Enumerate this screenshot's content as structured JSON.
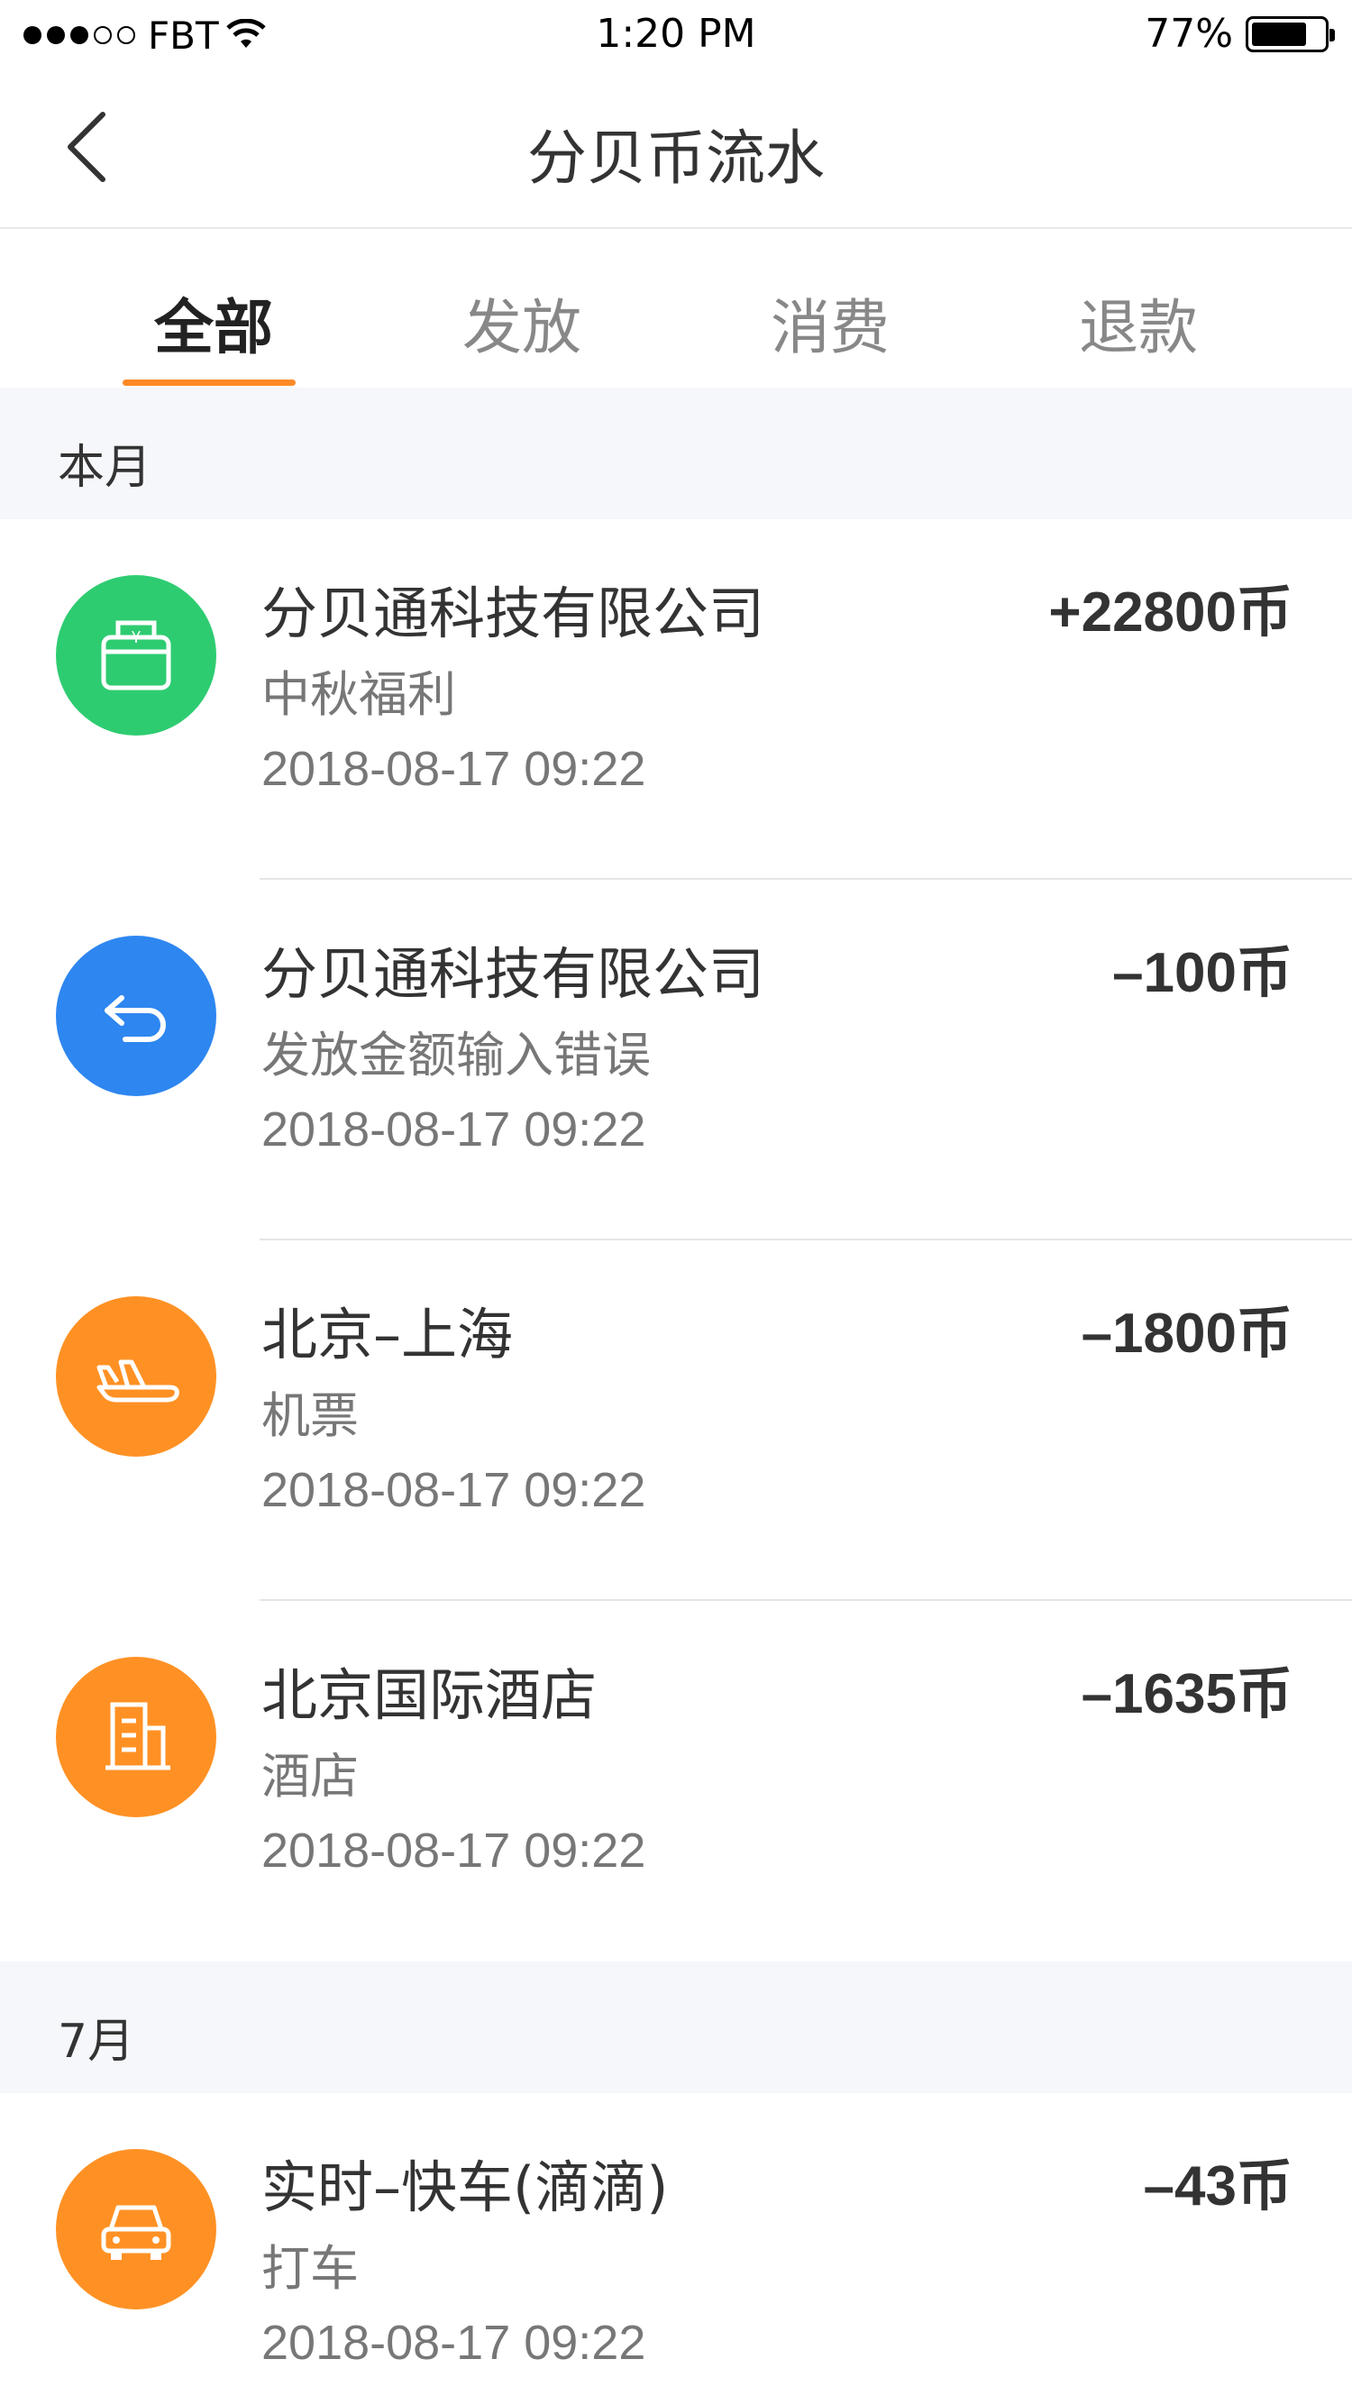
{
  "status_bar": {
    "carrier": "FBT",
    "time": "1:20 PM",
    "battery_percent": "77%",
    "battery_level": 0.77
  },
  "nav": {
    "title": "分贝币流水"
  },
  "tabs": [
    {
      "label": "全部",
      "active": true
    },
    {
      "label": "发放",
      "active": false
    },
    {
      "label": "消费",
      "active": false
    },
    {
      "label": "退款",
      "active": false
    }
  ],
  "sections": [
    {
      "header": "本月",
      "items": [
        {
          "title": "分贝通科技有限公司",
          "subtitle": "中秋福利",
          "time": "2018-08-17 09:22",
          "amount": "+22800币",
          "icon": "wallet-yen-icon",
          "icon_color": "#2ecc71"
        },
        {
          "title": "分贝通科技有限公司",
          "subtitle": "发放金额输入错误",
          "time": "2018-08-17 09:22",
          "amount": "–100币",
          "icon": "return-arrow-icon",
          "icon_color": "#2e86f0"
        },
        {
          "title": "北京–上海",
          "subtitle": "机票",
          "time": "2018-08-17 09:22",
          "amount": "–1800币",
          "icon": "airplane-icon",
          "icon_color": "#ff9124"
        },
        {
          "title": "北京国际酒店",
          "subtitle": "酒店",
          "time": "2018-08-17 09:22",
          "amount": "–1635币",
          "icon": "hotel-building-icon",
          "icon_color": "#ff9124"
        }
      ]
    },
    {
      "header": "7月",
      "items": [
        {
          "title": "实时–快车(滴滴)",
          "subtitle": "打车",
          "time": "2018-08-17 09:22",
          "amount": "–43币",
          "icon": "car-icon",
          "icon_color": "#ff9124"
        }
      ]
    }
  ]
}
